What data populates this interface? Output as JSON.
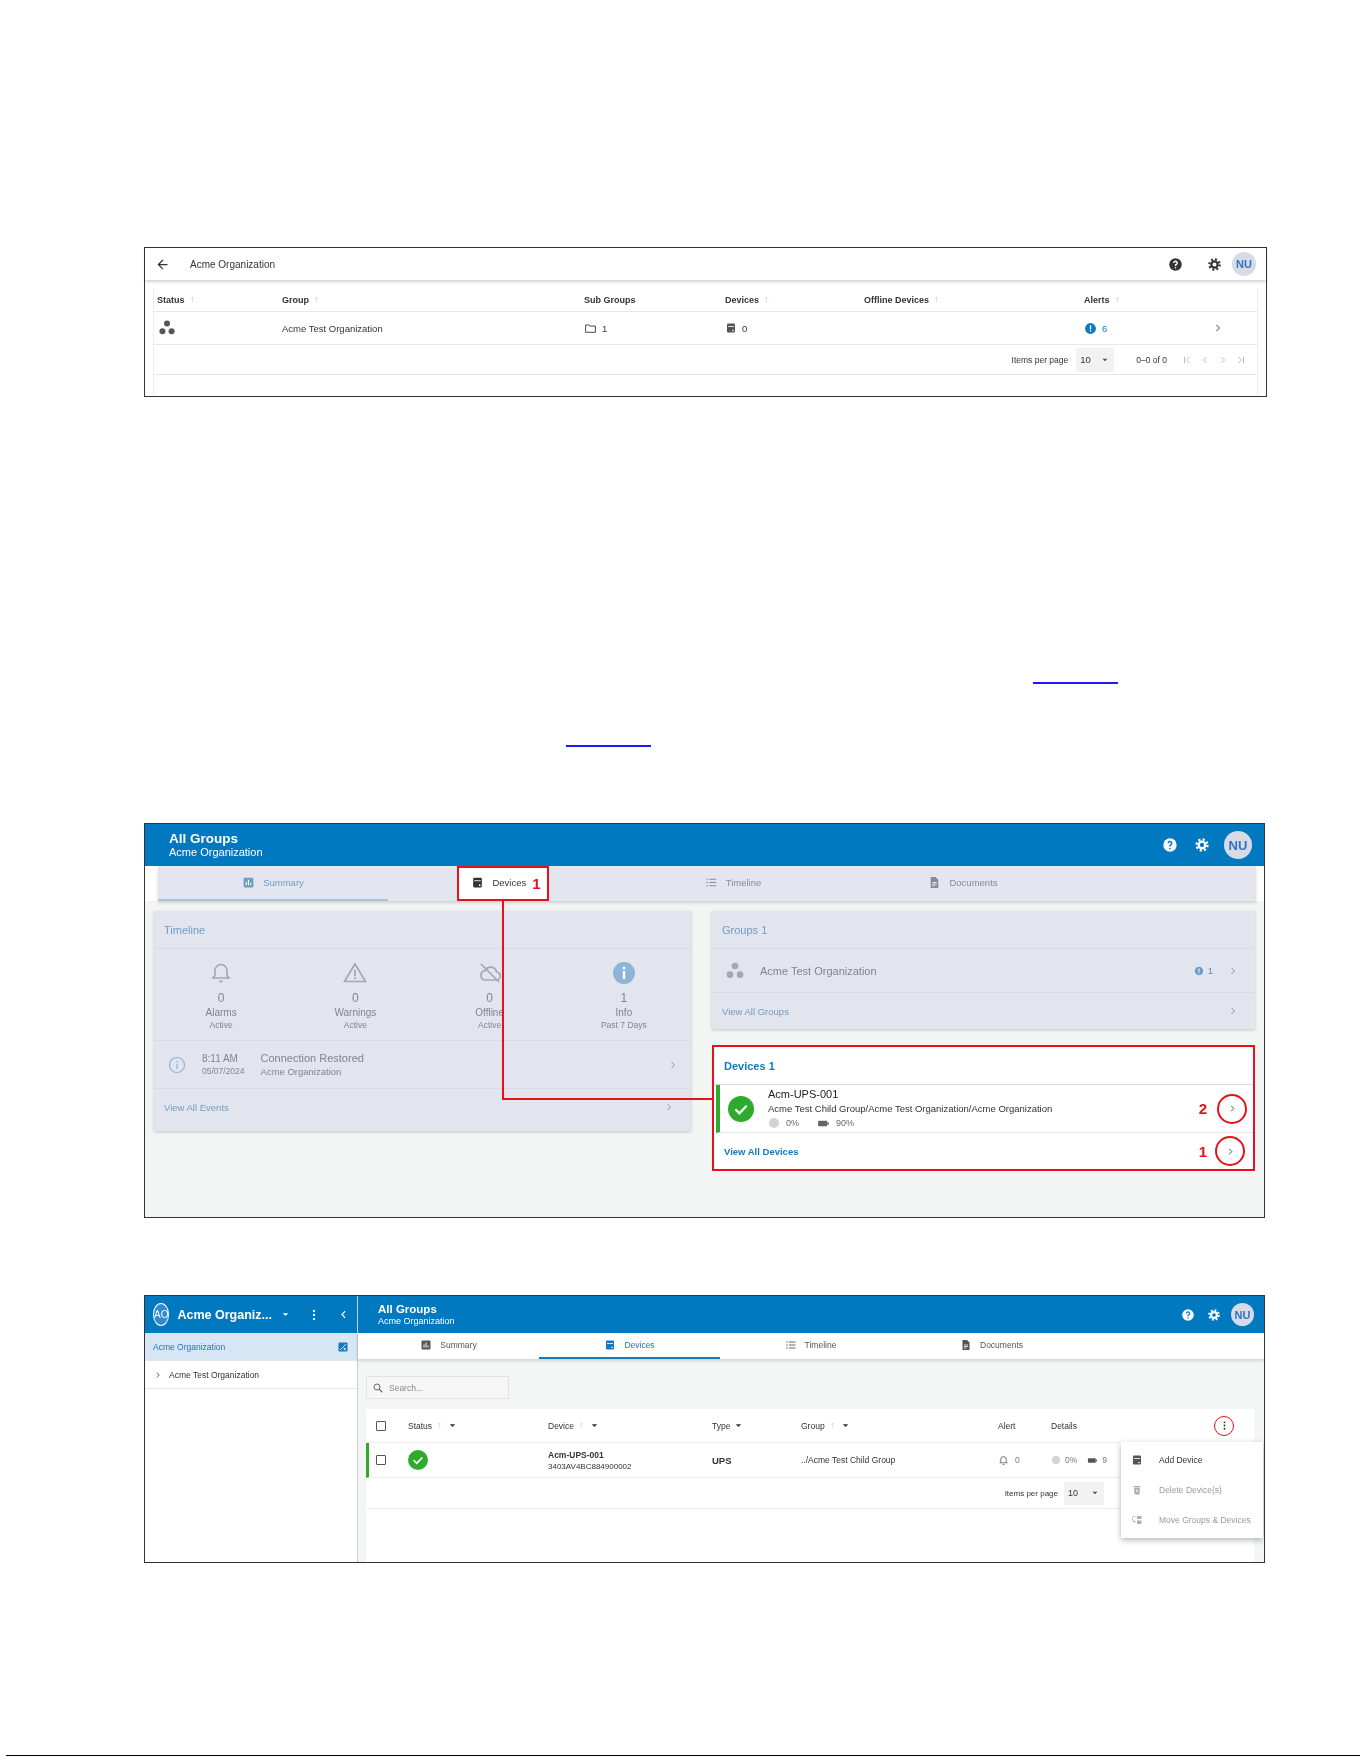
{
  "group_list_screen": {
    "title": "Acme Organization",
    "avatar": "NU",
    "columns": [
      {
        "label": "Status",
        "sortable": true
      },
      {
        "label": "Group",
        "sortable": true
      },
      {
        "label": "Sub Groups",
        "sortable": false
      },
      {
        "label": "Devices",
        "sortable": true
      },
      {
        "label": "Offline Devices",
        "sortable": true
      },
      {
        "label": "Alerts",
        "sortable": true
      }
    ],
    "rows": [
      {
        "group": "Acme Test Organization",
        "sub_groups": "1",
        "devices": "0",
        "alerts": "6"
      }
    ],
    "paginator": {
      "label": "Items per page",
      "page_size": "10",
      "range": "0–0 of 0"
    }
  },
  "dashboard_screen": {
    "header": {
      "title": "All Groups",
      "subtitle": "Acme Organization",
      "avatar": "NU"
    },
    "tabs": [
      {
        "label": "Summary",
        "kind": "summary",
        "selected": true,
        "highlighted": false
      },
      {
        "label": "Devices",
        "kind": "devices",
        "selected": false,
        "highlighted": true,
        "callout": "1"
      },
      {
        "label": "Timeline",
        "kind": "timeline",
        "selected": false,
        "highlighted": false
      },
      {
        "label": "Documents",
        "kind": "documents",
        "selected": false,
        "highlighted": false
      }
    ],
    "timeline_card": {
      "title": "Timeline",
      "highlighted": false,
      "stats": [
        {
          "kind": "alarm",
          "count": "0",
          "label": "Alarms",
          "sublabel": "Active"
        },
        {
          "kind": "warning",
          "count": "0",
          "label": "Warnings",
          "sublabel": "Active"
        },
        {
          "kind": "offline",
          "count": "0",
          "label": "Offline",
          "sublabel": "Active"
        },
        {
          "kind": "info",
          "count": "1",
          "label": "Info",
          "sublabel": "Past 7 Days"
        }
      ],
      "events": [
        {
          "time": "8:11",
          "meridiem": "AM",
          "date": "05/07/2024",
          "title": "Connection Restored",
          "subtitle": "Acme Organization"
        }
      ],
      "footer_link": "View All Events"
    },
    "groups_card": {
      "title": "Groups 1",
      "highlighted": false,
      "rows": [
        {
          "name": "Acme Test Organization",
          "alerts": "1"
        }
      ],
      "footer_link": "View All Groups"
    },
    "devices_card": {
      "title": "Devices 1",
      "highlighted": true,
      "rows": [
        {
          "name": "Acm-UPS-001",
          "path": "Acme Test Child Group/Acme Test Organization/Acme Organization",
          "signal": "0%",
          "battery": "90%",
          "kind": "online",
          "callout": "2"
        }
      ],
      "footer_link": "View All Devices",
      "footer_callout": "1"
    }
  },
  "devices_screen": {
    "sidebar": {
      "org": {
        "initials": "AO",
        "name": "Acme Organiz..."
      },
      "items": [
        {
          "label": "Acme Organization",
          "kind": "root",
          "selected": true
        },
        {
          "label": "Acme Test Organization",
          "kind": "node",
          "selected": false,
          "expanded": false
        }
      ]
    },
    "header": {
      "title": "All Groups",
      "subtitle": "Acme Organization",
      "avatar": "NU"
    },
    "tabs": [
      {
        "label": "Summary",
        "kind": "summary",
        "selected": false
      },
      {
        "label": "Devices",
        "kind": "devices",
        "selected": true
      },
      {
        "label": "Timeline",
        "kind": "timeline",
        "selected": false
      },
      {
        "label": "Documents",
        "kind": "documents",
        "selected": false
      }
    ],
    "search": {
      "placeholder": "Search..."
    },
    "table": {
      "all_checked": false,
      "columns": [
        {
          "label": "Status",
          "sortable": true,
          "filterable": true
        },
        {
          "label": "Device",
          "sortable": true,
          "filterable": true
        },
        {
          "label": "Type",
          "sortable": false,
          "filterable": true
        },
        {
          "label": "Group",
          "sortable": true,
          "filterable": true
        },
        {
          "label": "Alert",
          "sortable": false,
          "filterable": false
        },
        {
          "label": "Details",
          "sortable": false,
          "filterable": false
        }
      ],
      "rows": [
        {
          "checked": false,
          "kind": "online",
          "device": "Acm-UPS-001",
          "serial": "3403AV4BC884900002",
          "type": "UPS",
          "group": "../Acme Test Child Group",
          "alerts": "0",
          "signal": "0%",
          "battery": "9"
        }
      ],
      "paginator": {
        "label": "Items per page",
        "page_size": "10"
      }
    },
    "actions_menu": {
      "open": true,
      "items": [
        {
          "label": "Add Device",
          "kind": "add",
          "disabled": false
        },
        {
          "label": "Delete Device(s)",
          "kind": "delete",
          "disabled": true
        },
        {
          "label": "Move Groups & Devices",
          "kind": "move",
          "disabled": true
        }
      ]
    }
  }
}
